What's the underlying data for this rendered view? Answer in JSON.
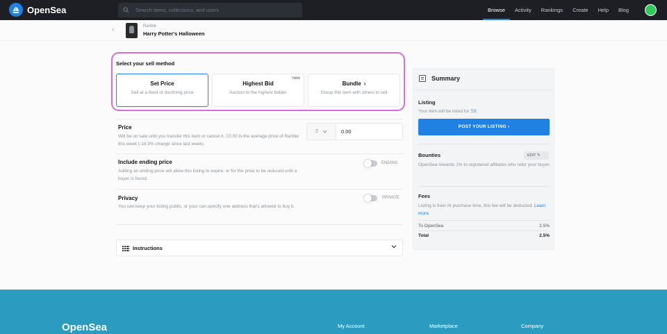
{
  "nav": {
    "brand": "OpenSea",
    "search_placeholder": "Search items, collections, and users",
    "links": [
      "Browse",
      "Activity",
      "Rankings",
      "Create",
      "Help",
      "Blog"
    ]
  },
  "item": {
    "collection": "Rarible",
    "name": "Harry Potter's Halloween"
  },
  "sell_method": {
    "title": "Select your sell method",
    "options": [
      {
        "label": "Set Price",
        "desc": "Sell at a fixed or declining price"
      },
      {
        "label": "Highest Bid",
        "desc": "Auction to the highest bidder",
        "badge": "new"
      },
      {
        "label": "Bundle",
        "desc": "Group this item with others to sell"
      }
    ]
  },
  "form": {
    "price_title": "Price",
    "price_desc": "Will be on sale until you transfer this item or cancel it. Ξ0.00 is the average price of Rarible this week (-18.9% change since last week).",
    "price_token": "Ξ",
    "price_value": "0.00",
    "ending_title": "Include ending price",
    "ending_desc": "Adding an ending price will allow this listing to expire, or for the price to be reduced until a buyer is found.",
    "ending_toggle": "ENDING",
    "privacy_title": "Privacy",
    "privacy_desc": "You can keep your listing public, or your can specify one address that's allowed to buy it.",
    "privacy_toggle": "PRIVATE",
    "instructions": "Instructions"
  },
  "summary": {
    "title": "Summary",
    "listing_title": "Listing",
    "listing_text": "Your item will be listed for",
    "listing_amount": "Ξ0",
    "listing_end": ".",
    "post_button": "POST YOUR LISTING ›",
    "bounties_title": "Bounties",
    "edit": "EDIT",
    "bounties_text": "OpenSea rewards 1% to registered affiliates who refer your buyer.",
    "fees_title": "Fees",
    "fees_text": "Listing is free! At purchase time, this fee will be deducted.",
    "learn_more": "Learn more.",
    "fee_rows": [
      {
        "label": "To OpenSea",
        "value": "2.5%"
      },
      {
        "label": "Total",
        "value": "2.5%"
      }
    ]
  },
  "footer": {
    "brand": "OpenSea",
    "columns": [
      "My Account",
      "Marketplace",
      "Company"
    ]
  },
  "colors": {
    "accent": "#2081e2",
    "highlight_border": "#d66ddf",
    "footer": "#2b9cc0",
    "nav_bg": "#1d1f24"
  }
}
